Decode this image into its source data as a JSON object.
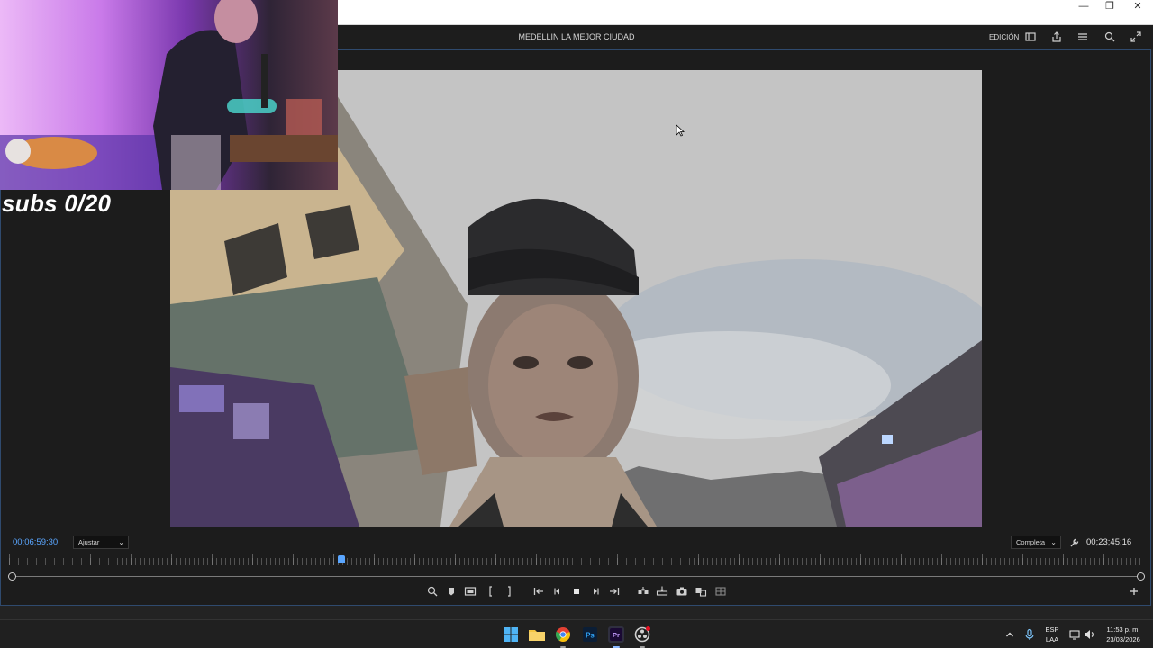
{
  "window": {
    "minimize": "—",
    "restore": "❐",
    "close": "✕"
  },
  "header": {
    "title": "MEDELLIN LA MEJOR CIUDAD",
    "workspace": "EDICIÓN"
  },
  "overlay": {
    "subs_text": "subs 0/20"
  },
  "monitor": {
    "timecode_current": "00;06;59;30",
    "zoom_level": "Ajustar",
    "resolution": "Completa",
    "timecode_duration": "00;23;45;16"
  },
  "taskbar": {
    "lang_top": "ESP",
    "lang_bottom": "LAA",
    "time": "11:53 p. m.",
    "date": "23/03/2026"
  },
  "colors": {
    "accent": "#5aa6ff",
    "panel_border": "#2f4a6e"
  }
}
